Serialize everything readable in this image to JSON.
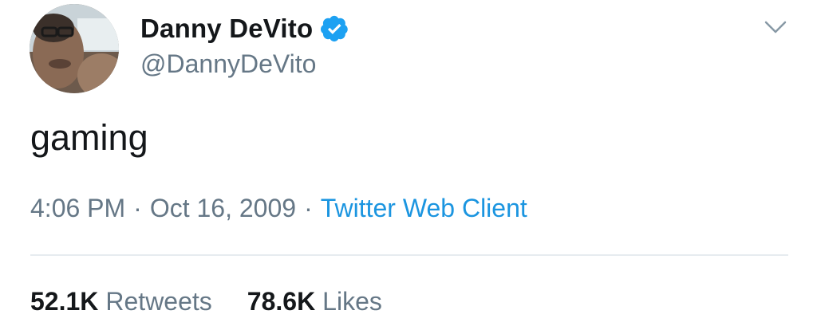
{
  "author": {
    "display_name": "Danny DeVito",
    "handle": "@DannyDeVito",
    "verified": true
  },
  "tweet": {
    "text": "gaming",
    "time": "4:06 PM",
    "separator": "·",
    "date": "Oct 16, 2009",
    "source": "Twitter Web Client"
  },
  "stats": {
    "retweets_count": "52.1K",
    "retweets_label": "Retweets",
    "likes_count": "78.6K",
    "likes_label": "Likes"
  },
  "icons": {
    "verified": "verified-badge-icon",
    "menu": "chevron-down-icon"
  },
  "colors": {
    "text_primary": "#14171a",
    "text_secondary": "#657786",
    "link": "#1b95e0",
    "verified": "#1da1f2",
    "divider": "#e6ecf0"
  }
}
